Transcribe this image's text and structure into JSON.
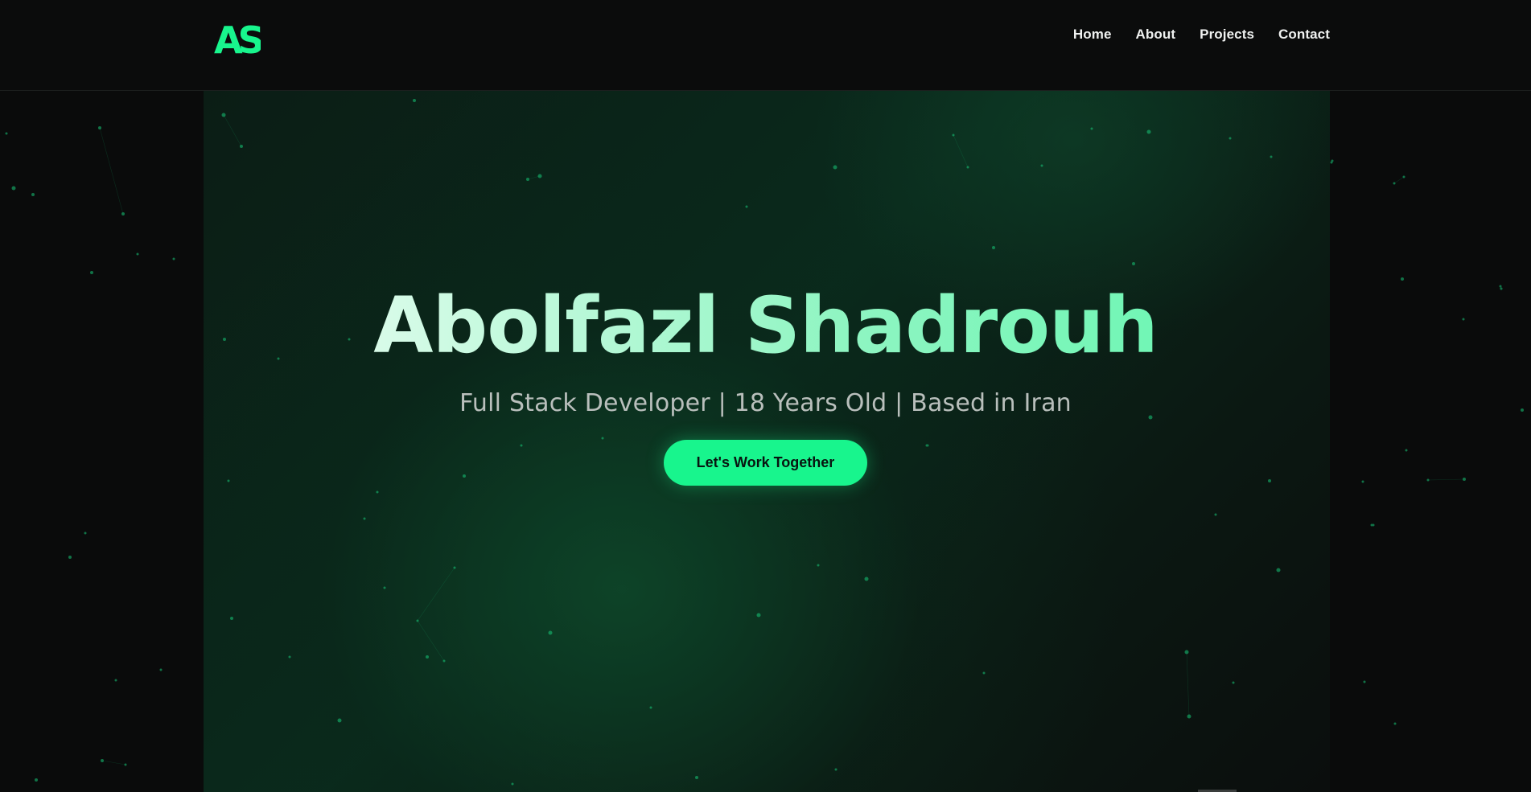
{
  "brand": {
    "logo_text": "AS",
    "accent": "#18f58d"
  },
  "nav": {
    "items": [
      {
        "label": "Home"
      },
      {
        "label": "About"
      },
      {
        "label": "Projects"
      },
      {
        "label": "Contact"
      }
    ]
  },
  "hero": {
    "title": "Abolfazl Shadrouh",
    "subtitle": "Full Stack Developer | 18 Years Old | Based in Iran",
    "cta_label": "Let's Work Together"
  },
  "colors": {
    "background": "#0a0b0b",
    "hero_green": "#0a2a1c",
    "text_muted": "#b9bfbc",
    "particle": "#18c77a"
  }
}
